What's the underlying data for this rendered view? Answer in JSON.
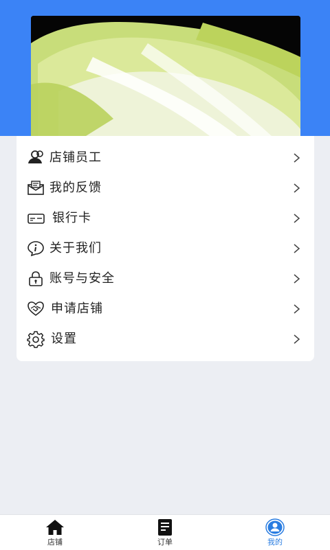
{
  "menu": {
    "items": [
      {
        "label": "店铺员工",
        "icon": "staff-icon"
      },
      {
        "label": "我的反馈",
        "icon": "feedback-icon"
      },
      {
        "label": "银行卡",
        "icon": "bank-card-icon"
      },
      {
        "label": "关于我们",
        "icon": "info-icon"
      },
      {
        "label": "账号与安全",
        "icon": "lock-icon"
      },
      {
        "label": "申请店铺",
        "icon": "handshake-icon"
      },
      {
        "label": "设置",
        "icon": "gear-icon"
      }
    ]
  },
  "tabbar": {
    "tabs": [
      {
        "label": "店铺",
        "icon": "home-icon"
      },
      {
        "label": "订单",
        "icon": "order-icon"
      },
      {
        "label": "我的",
        "icon": "profile-icon",
        "active": true
      }
    ]
  },
  "colors": {
    "header": "#3b83f6",
    "background": "#eceef3",
    "active_tab": "#2a7de1"
  }
}
